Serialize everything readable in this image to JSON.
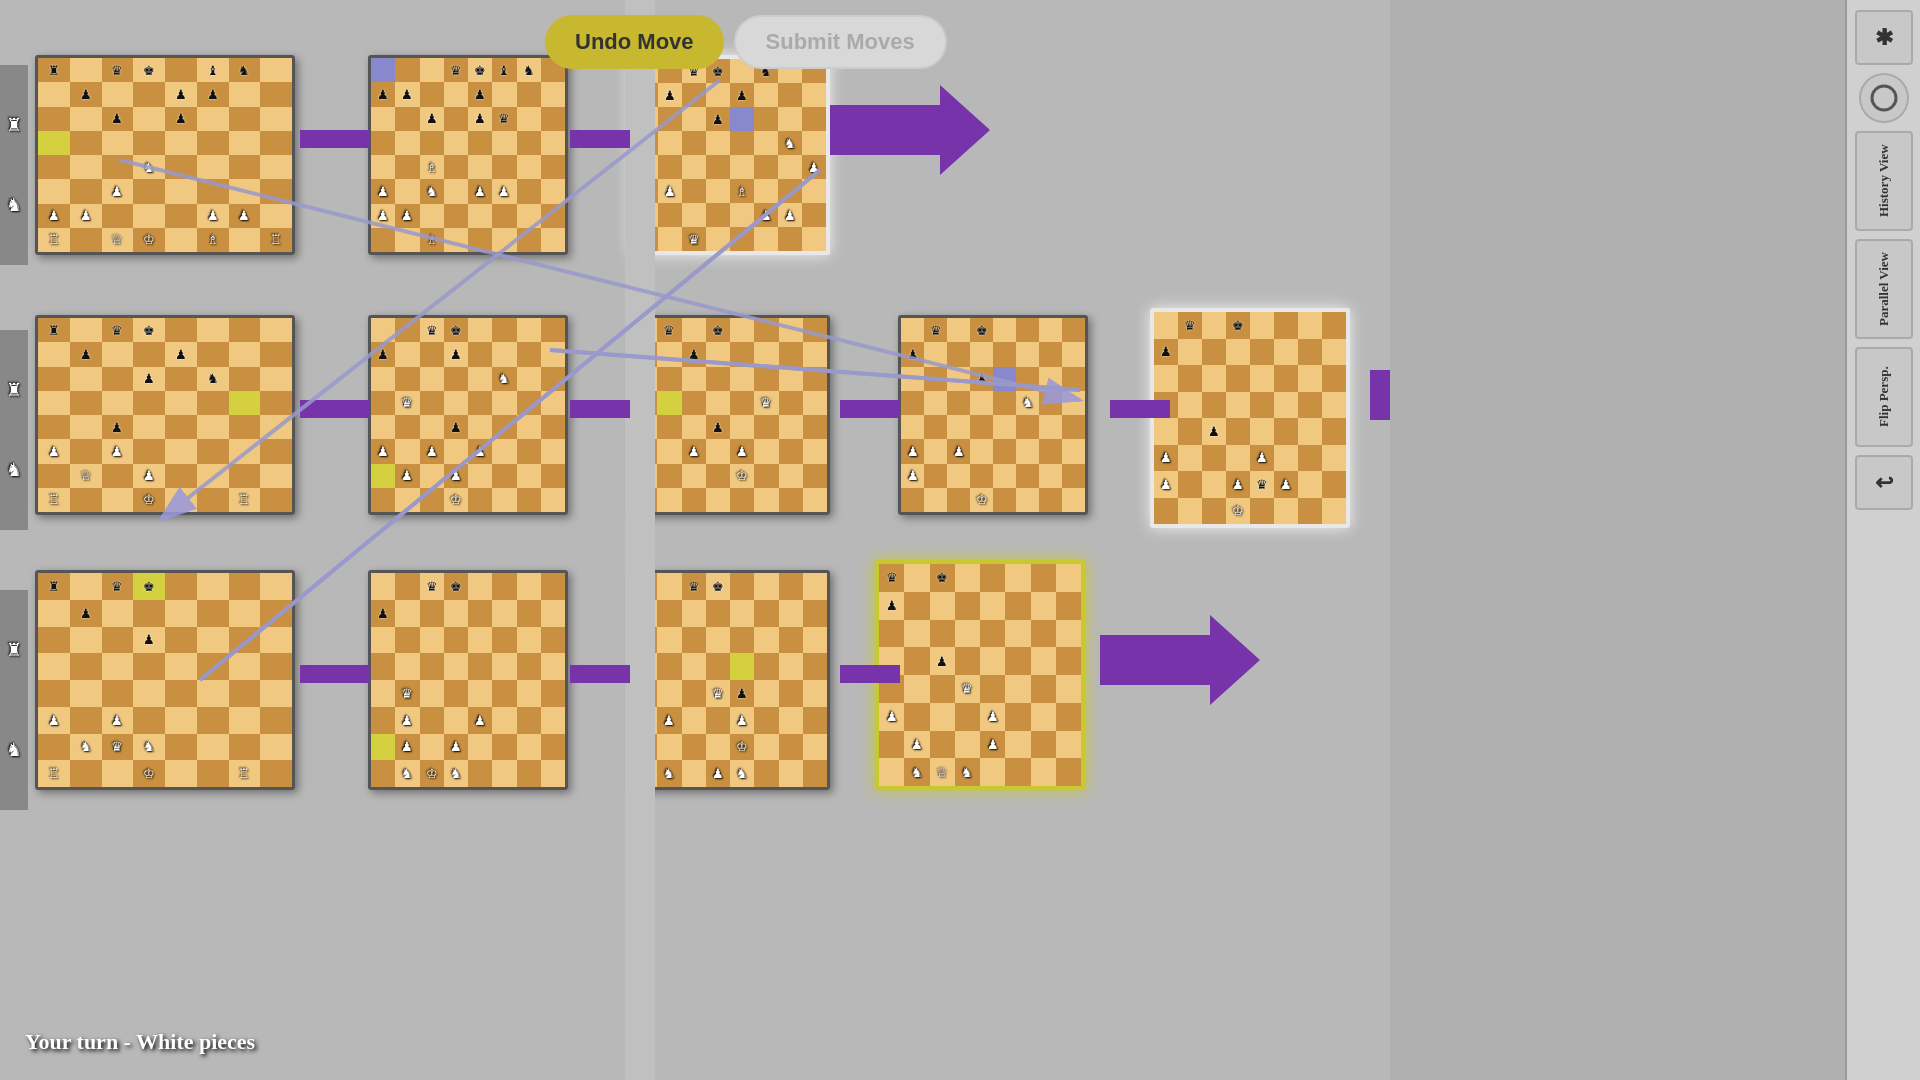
{
  "buttons": {
    "undo_label": "Undo Move",
    "submit_label": "Submit Moves"
  },
  "sidebar": {
    "star_label": "✱",
    "circle_label": "○",
    "history_label": "History View",
    "parallel_label": "Parallel View",
    "flip_label": "Flip Persp.",
    "back_label": "↩"
  },
  "status": {
    "text": "Your turn - White pieces"
  },
  "accent": {
    "yellow": "#c8c830",
    "purple": "#7733aa",
    "blue": "#8888cc"
  }
}
